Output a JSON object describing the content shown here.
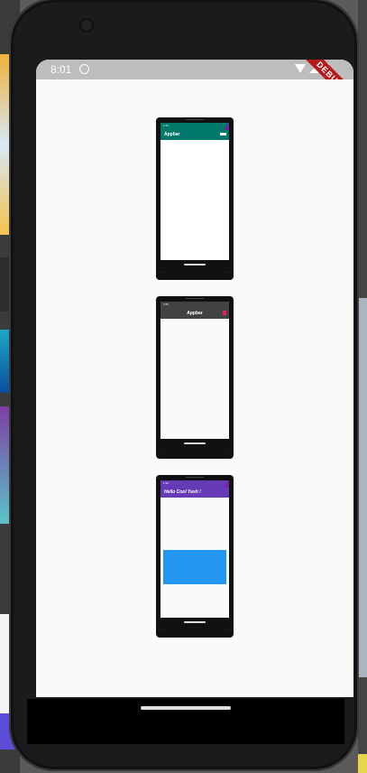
{
  "status_bar": {
    "time": "8:01"
  },
  "debug_banner": {
    "label": "DEBUG"
  },
  "previews": [
    {
      "name": "teal-appbar-preview",
      "appbar_title": "Appbar",
      "accent": "#00796b"
    },
    {
      "name": "grey-appbar-preview",
      "appbar_title": "Appbar",
      "accent": "#424242"
    },
    {
      "name": "purple-appbar-preview",
      "appbar_title": "Hello Cool Yash !",
      "accent": "#673ab7",
      "body_block_color": "#2196f3"
    }
  ],
  "colors": {
    "screen_bg": "#fafafa",
    "status_bar_bg": "#bdbdbd",
    "debug_red": "#b71c1c"
  }
}
